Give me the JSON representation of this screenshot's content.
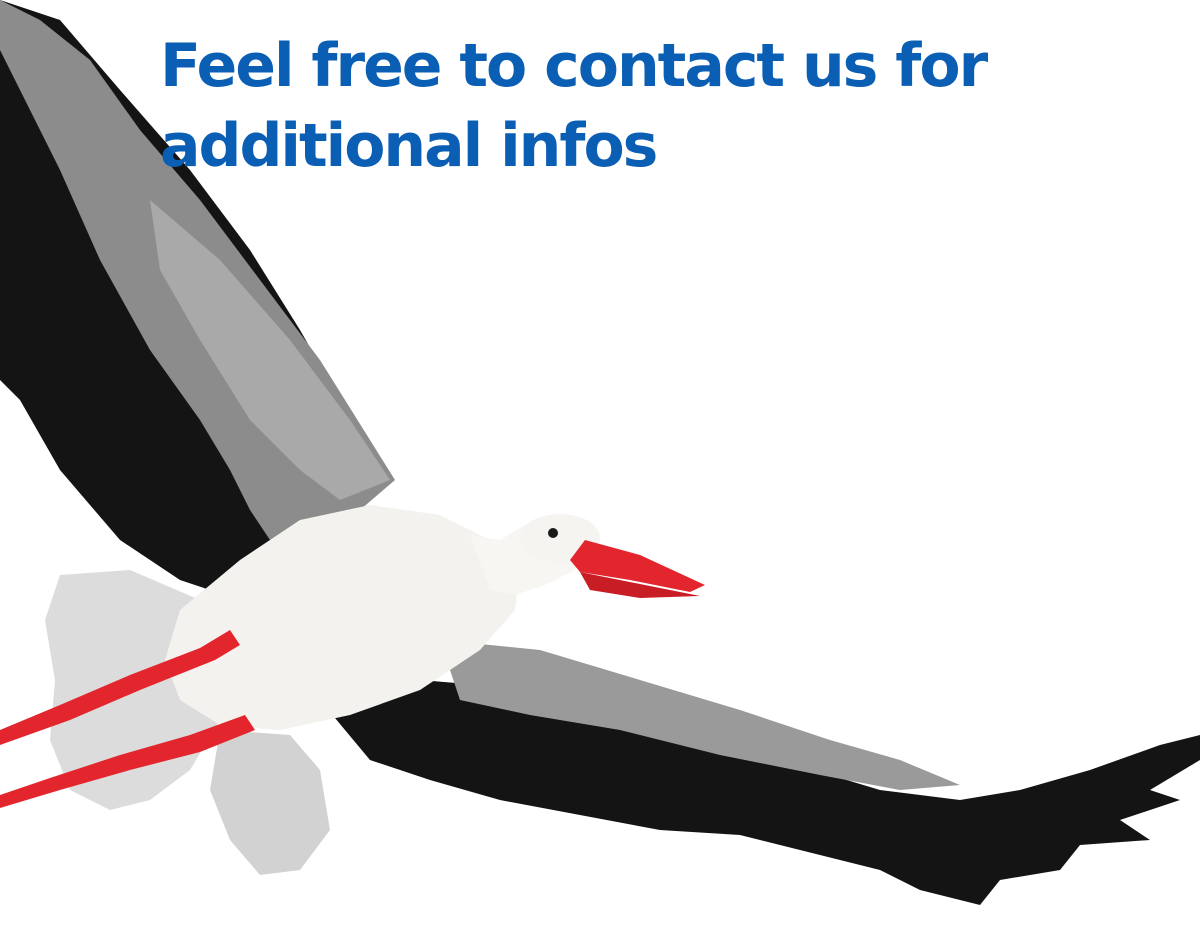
{
  "headline": {
    "text": "Feel free to contact us for additional infos"
  },
  "image": {
    "subject": "stork-in-flight",
    "colors": {
      "headline": "#0a5fb4",
      "wing_black": "#141414",
      "wing_gray": "#8a8a8a",
      "body_white": "#f4f2ef",
      "beak_legs": "#e3262e"
    }
  }
}
